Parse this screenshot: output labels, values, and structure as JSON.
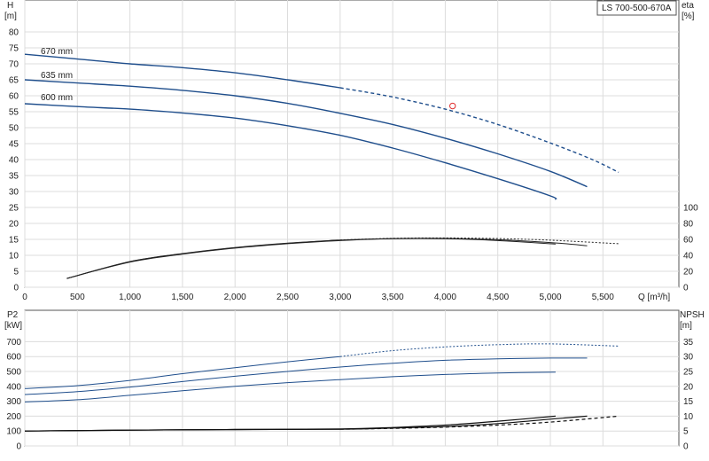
{
  "chart_data": [
    {
      "type": "line",
      "panel": "head-efficiency",
      "title": "LS 700-500-670A",
      "ylabel_left": [
        "H",
        "[m]"
      ],
      "ylabel_right": [
        "eta",
        "[%]"
      ],
      "xlabel": "Q [m³/h]",
      "xlim": [
        0,
        5750
      ],
      "ylim_left": [
        0,
        85
      ],
      "ylim_right": [
        0,
        125
      ],
      "x_ticks": [
        0,
        500,
        1000,
        1500,
        2000,
        2500,
        3000,
        3500,
        4000,
        4500,
        5000,
        5500
      ],
      "x_tick_labels": [
        "0",
        "500",
        "1,000",
        "1,500",
        "2,000",
        "2,500",
        "3,000",
        "3,500",
        "4,000",
        "4,500",
        "5,000",
        "5,500"
      ],
      "y_left_ticks": [
        0,
        5,
        10,
        15,
        20,
        25,
        30,
        35,
        40,
        45,
        50,
        55,
        60,
        65,
        70,
        75,
        80
      ],
      "y_right_ticks": [
        0,
        20,
        40,
        60,
        80,
        100
      ],
      "grid": true,
      "head_series": [
        {
          "name": "670 mm",
          "color": "#1f4e8c",
          "x": [
            0,
            500,
            1000,
            1500,
            2000,
            2500,
            3000,
            3500,
            4000,
            4500,
            5000,
            5400,
            5650
          ],
          "y": [
            73,
            71.5,
            70,
            68.8,
            67.2,
            65,
            62.5,
            59.6,
            55.8,
            51,
            45.2,
            40,
            36
          ],
          "solid_until": 3000
        },
        {
          "name": "635 mm",
          "color": "#1f4e8c",
          "x": [
            0,
            500,
            1000,
            1500,
            2000,
            2500,
            3000,
            3500,
            4000,
            4500,
            5000,
            5350
          ],
          "y": [
            65,
            64,
            63,
            61.7,
            60,
            57.6,
            54.5,
            51,
            46.7,
            41.8,
            36.3,
            31.5
          ]
        },
        {
          "name": "600 mm",
          "color": "#1f4e8c",
          "x": [
            0,
            500,
            1000,
            1500,
            2000,
            2500,
            3000,
            3500,
            4000,
            4500,
            5000,
            5050
          ],
          "y": [
            57.5,
            56.6,
            55.8,
            54.6,
            53,
            50.6,
            47.6,
            43.6,
            39,
            34,
            28.6,
            27.5
          ]
        }
      ],
      "efficiency_series": [
        {
          "x": [
            400,
            1000,
            1500,
            2000,
            2500,
            3000,
            3500,
            4000,
            4500,
            5000,
            5350
          ],
          "y": [
            11,
            32,
            42,
            49.5,
            55,
            59,
            61,
            61.2,
            59.5,
            56,
            52
          ]
        },
        {
          "x": [
            400,
            1000,
            1500,
            2000,
            2500,
            3000,
            3500,
            4000,
            4500,
            5050
          ],
          "y": [
            11,
            31.5,
            41.5,
            49,
            54.5,
            58.5,
            60.8,
            60.8,
            58.5,
            54
          ]
        },
        {
          "x": [
            400,
            1000,
            1500,
            2000,
            2500,
            3000,
            3500,
            4000,
            4500,
            5000,
            5650
          ],
          "y": [
            11,
            32.2,
            42.2,
            49.8,
            55.3,
            59.2,
            61.3,
            61.8,
            61,
            59,
            54.5
          ],
          "solid_until": 3000
        }
      ],
      "marker": {
        "x": 4070,
        "y": 56.8,
        "color": "#e03030"
      }
    },
    {
      "type": "line",
      "panel": "power-npsh",
      "ylabel_left": [
        "P2",
        "[kW]"
      ],
      "ylabel_right": [
        "NPSH",
        "[m]"
      ],
      "xlim": [
        0,
        5750
      ],
      "ylim_left": [
        0,
        800
      ],
      "ylim_right": [
        0,
        40
      ],
      "y_left_ticks": [
        0,
        100,
        200,
        300,
        400,
        500,
        600,
        700
      ],
      "y_right_ticks": [
        0,
        5,
        10,
        15,
        20,
        25,
        30,
        35
      ],
      "grid": true,
      "power_series": [
        {
          "x": [
            0,
            500,
            1000,
            1500,
            2000,
            2500,
            3000,
            3500,
            4000,
            4500,
            5000,
            5650
          ],
          "y": [
            385,
            405,
            440,
            485,
            525,
            565,
            600,
            640,
            665,
            680,
            685,
            670
          ],
          "solid_until": 3000
        },
        {
          "x": [
            0,
            500,
            1000,
            1500,
            2000,
            2500,
            3000,
            3500,
            4000,
            4500,
            5000,
            5350
          ],
          "y": [
            345,
            365,
            395,
            432,
            468,
            500,
            530,
            555,
            575,
            585,
            590,
            590
          ]
        },
        {
          "x": [
            0,
            500,
            1000,
            1500,
            2000,
            2500,
            3000,
            3500,
            4000,
            4500,
            5050
          ],
          "y": [
            295,
            310,
            340,
            370,
            400,
            425,
            445,
            465,
            480,
            490,
            495
          ]
        }
      ],
      "npsh_series": [
        {
          "x": [
            0,
            1000,
            2000,
            3000,
            3500,
            4000,
            4500,
            5000,
            5350
          ],
          "y": [
            5,
            5.3,
            5.5,
            5.6,
            6,
            6.5,
            7.5,
            9,
            10
          ]
        },
        {
          "x": [
            0,
            1000,
            2000,
            3000,
            3500,
            4000,
            4500,
            5050
          ],
          "y": [
            5,
            5.3,
            5.5,
            5.7,
            6.2,
            7,
            8.3,
            10
          ]
        },
        {
          "x": [
            0,
            1000,
            2000,
            3000,
            3500,
            4000,
            4500,
            5000,
            5650
          ],
          "y": [
            5,
            5.3,
            5.5,
            5.6,
            5.9,
            6.3,
            7,
            8,
            10
          ],
          "solid_until": 3000
        }
      ]
    }
  ]
}
